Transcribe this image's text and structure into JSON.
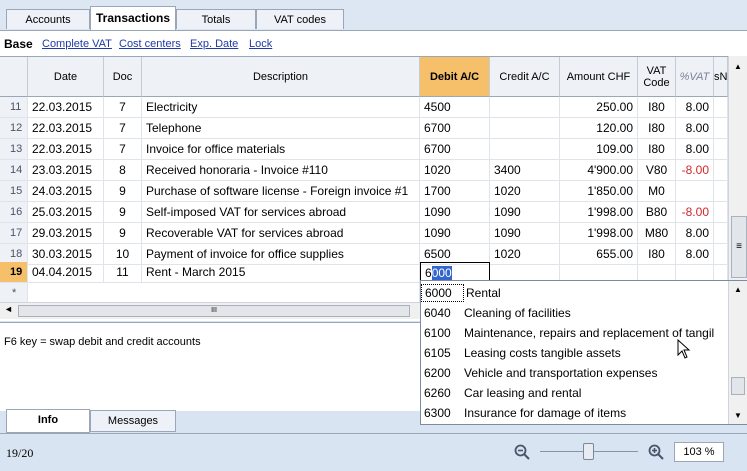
{
  "tabs": [
    {
      "label": "Accounts"
    },
    {
      "label": "Transactions"
    },
    {
      "label": "Totals"
    },
    {
      "label": "VAT codes"
    }
  ],
  "views": [
    {
      "label": "Base"
    },
    {
      "label": "Complete VAT"
    },
    {
      "label": "Cost centers"
    },
    {
      "label": "Exp. Date"
    },
    {
      "label": "Lock"
    }
  ],
  "columns": {
    "date": "Date",
    "doc": "Doc",
    "description": "Description",
    "debit": "Debit A/C",
    "credit": "Credit A/C",
    "amount": "Amount CHF",
    "vatcode": "VAT Code",
    "pctvat": "%VAT",
    "sn": "sN"
  },
  "rows": [
    {
      "n": "11",
      "date": "22.03.2015",
      "doc": "7",
      "desc": "Electricity",
      "debit": "4500",
      "credit": "",
      "amount": "250.00",
      "vat": "I80",
      "pct": "8.00",
      "neg": false
    },
    {
      "n": "12",
      "date": "22.03.2015",
      "doc": "7",
      "desc": "Telephone",
      "debit": "6700",
      "credit": "",
      "amount": "120.00",
      "vat": "I80",
      "pct": "8.00",
      "neg": false
    },
    {
      "n": "13",
      "date": "22.03.2015",
      "doc": "7",
      "desc": "Invoice for office materials",
      "debit": "6700",
      "credit": "",
      "amount": "109.00",
      "vat": "I80",
      "pct": "8.00",
      "neg": false
    },
    {
      "n": "14",
      "date": "23.03.2015",
      "doc": "8",
      "desc": "Received honoraria - Invoice #110",
      "debit": "1020",
      "credit": "3400",
      "amount": "4'900.00",
      "vat": "V80",
      "pct": "-8.00",
      "neg": true
    },
    {
      "n": "15",
      "date": "24.03.2015",
      "doc": "9",
      "desc": "Purchase of software license - Foreign invoice #1",
      "debit": "1700",
      "credit": "1020",
      "amount": "1'850.00",
      "vat": "M0",
      "pct": "",
      "neg": false
    },
    {
      "n": "16",
      "date": "25.03.2015",
      "doc": "9",
      "desc": "Self-imposed VAT for services abroad",
      "debit": "1090",
      "credit": "1090",
      "amount": "1'998.00",
      "vat": "B80",
      "pct": "-8.00",
      "neg": true
    },
    {
      "n": "17",
      "date": "29.03.2015",
      "doc": "9",
      "desc": "Recoverable VAT for services abroad",
      "debit": "1090",
      "credit": "1090",
      "amount": "1'998.00",
      "vat": "M80",
      "pct": "8.00",
      "neg": false
    },
    {
      "n": "18",
      "date": "30.03.2015",
      "doc": "10",
      "desc": "Payment of invoice for office supplies",
      "debit": "6500",
      "credit": "1020",
      "amount": "655.00",
      "vat": "I80",
      "pct": "8.00",
      "neg": false
    }
  ],
  "current_row": {
    "n": "19",
    "date": "04.04.2015",
    "doc": "11",
    "desc": "Rent - March 2015",
    "debit_typed": "6",
    "debit_completion": "000"
  },
  "new_row_marker": "*",
  "dropdown": [
    {
      "code": "6000",
      "name": "Rental"
    },
    {
      "code": "6040",
      "name": "Cleaning of facilities"
    },
    {
      "code": "6100",
      "name": "Maintenance, repairs and replacement of tangil"
    },
    {
      "code": "6105",
      "name": "Leasing costs tangible assets"
    },
    {
      "code": "6200",
      "name": "Vehicle and transportation expenses"
    },
    {
      "code": "6260",
      "name": "Car leasing and rental"
    },
    {
      "code": "6300",
      "name": "Insurance for damage of items"
    }
  ],
  "info_text": "F6 key = swap debit and credit accounts",
  "bottom_tabs": [
    {
      "label": "Info"
    },
    {
      "label": "Messages"
    }
  ],
  "status": {
    "position": "19/20",
    "zoom": "103 %"
  },
  "colors": {
    "selected_header": "#f6c06b",
    "link": "#1f3aa8",
    "negative": "#d4262a"
  },
  "hscroll_glyph": "III",
  "vscroll_glyph": "≡"
}
